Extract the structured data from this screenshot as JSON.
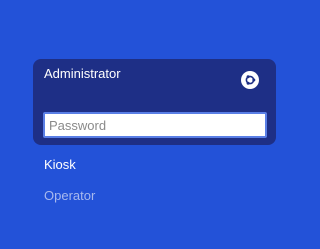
{
  "login": {
    "selected_user": "Administrator",
    "password_placeholder": "Password",
    "password_value": "",
    "session_icon": "ubuntu-logo-icon"
  },
  "user_list": [
    {
      "name": "Kiosk"
    },
    {
      "name": "Operator"
    }
  ],
  "colors": {
    "background": "#2352d8",
    "card": "#1e2f86",
    "input_focus_border": "#5a7fe6",
    "dim_user": "#a8b9ee"
  }
}
